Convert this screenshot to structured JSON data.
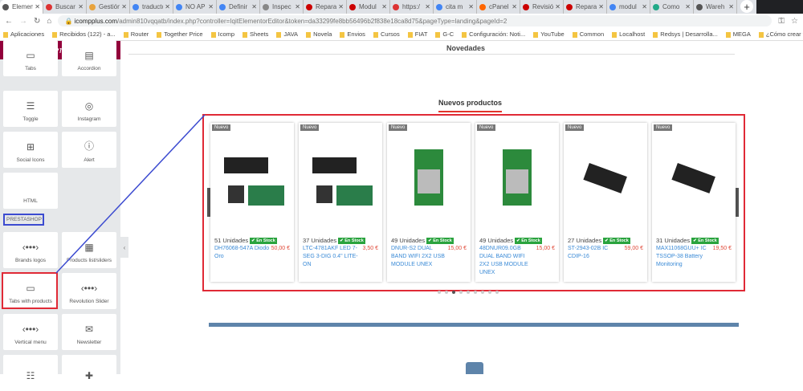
{
  "browser": {
    "tabs": [
      {
        "label": "Elementor",
        "color": "#555"
      },
      {
        "label": "Buscar",
        "color": "#d33"
      },
      {
        "label": "Gestión",
        "color": "#e8a33d"
      },
      {
        "label": "traductor",
        "color": "#4285f4"
      },
      {
        "label": "NO AP",
        "color": "#4285f4"
      },
      {
        "label": "Definir",
        "color": "#4285f4"
      },
      {
        "label": "Inspec",
        "color": "#888"
      },
      {
        "label": "Reparar",
        "color": "#c00"
      },
      {
        "label": "Modul",
        "color": "#c00"
      },
      {
        "label": "https:/",
        "color": "#d33"
      },
      {
        "label": "cita m",
        "color": "#4285f4"
      },
      {
        "label": "cPanel",
        "color": "#f60"
      },
      {
        "label": "Revisió",
        "color": "#c00"
      },
      {
        "label": "Repara",
        "color": "#c00"
      },
      {
        "label": "modul",
        "color": "#4285f4"
      },
      {
        "label": "Como",
        "color": "#2a8"
      },
      {
        "label": "Wareh",
        "color": "#555"
      }
    ],
    "url_domain": "icompplus.com",
    "url_path": "/admin810vqqatb/index.php?controller=IqitElementorEditor&token=da33299fe8bb56496b2f838e18ca8d75&pageType=landing&pageId=2",
    "bookmarks": [
      "Aplicaciones",
      "Recibidos (122) - a...",
      "Router",
      "Together Price",
      "Icomp",
      "Sheets",
      "JAVA",
      "Novela",
      "Envios",
      "Cursos",
      "FIAT",
      "G-C",
      "Configuración: Noti...",
      "YouTube",
      "Common",
      "Localhost",
      "Redsys | Desarrolla...",
      "MEGA",
      "¿Cómo crear formul..."
    ]
  },
  "editor": {
    "logo": "elementor",
    "widgets": [
      "Tabs",
      "Accordion",
      "Toggle",
      "Instagram",
      "Social Icons",
      "Alert",
      "HTML"
    ],
    "category": "PRESTASHOP",
    "prestashop_widgets": [
      "Brands logos",
      "Products list/sliders",
      "Tabs with products",
      "Revolution Slider",
      "Vertical menu",
      "Newsletter"
    ]
  },
  "page": {
    "section_title": "Novedades",
    "products_title": "Nuevos productos",
    "badge": "Nuevo",
    "stock_label": "En Stock",
    "products": [
      {
        "units": "51 Unidades",
        "name": "DH76068-547A Diodo Oro",
        "price": "50,00 €"
      },
      {
        "units": "37 Unidades",
        "name": "LTC-4781AKF LED 7-SEG 3-DIG 0.4\" LITE-ON",
        "price": "3,50 €"
      },
      {
        "units": "49 Unidades",
        "name": "DNUR-S2 DUAL BAND WIFI 2X2 USB MODULE UNEX",
        "price": "15,00 €"
      },
      {
        "units": "49 Unidades",
        "name": "48DNUR09.0GB DUAL BAND WIFI 2X2 USB MODULE UNEX",
        "price": "15,00 €"
      },
      {
        "units": "27 Unidades",
        "name": "ST-2943-02B IC CDIP-16",
        "price": "59,00 €"
      },
      {
        "units": "31 Unidades",
        "name": "MAX11068GUU+ IC TSSOP-38 Battery Monitoring",
        "price": "19,50 €"
      }
    ],
    "carousel_pages": 9,
    "carousel_active": 3
  }
}
